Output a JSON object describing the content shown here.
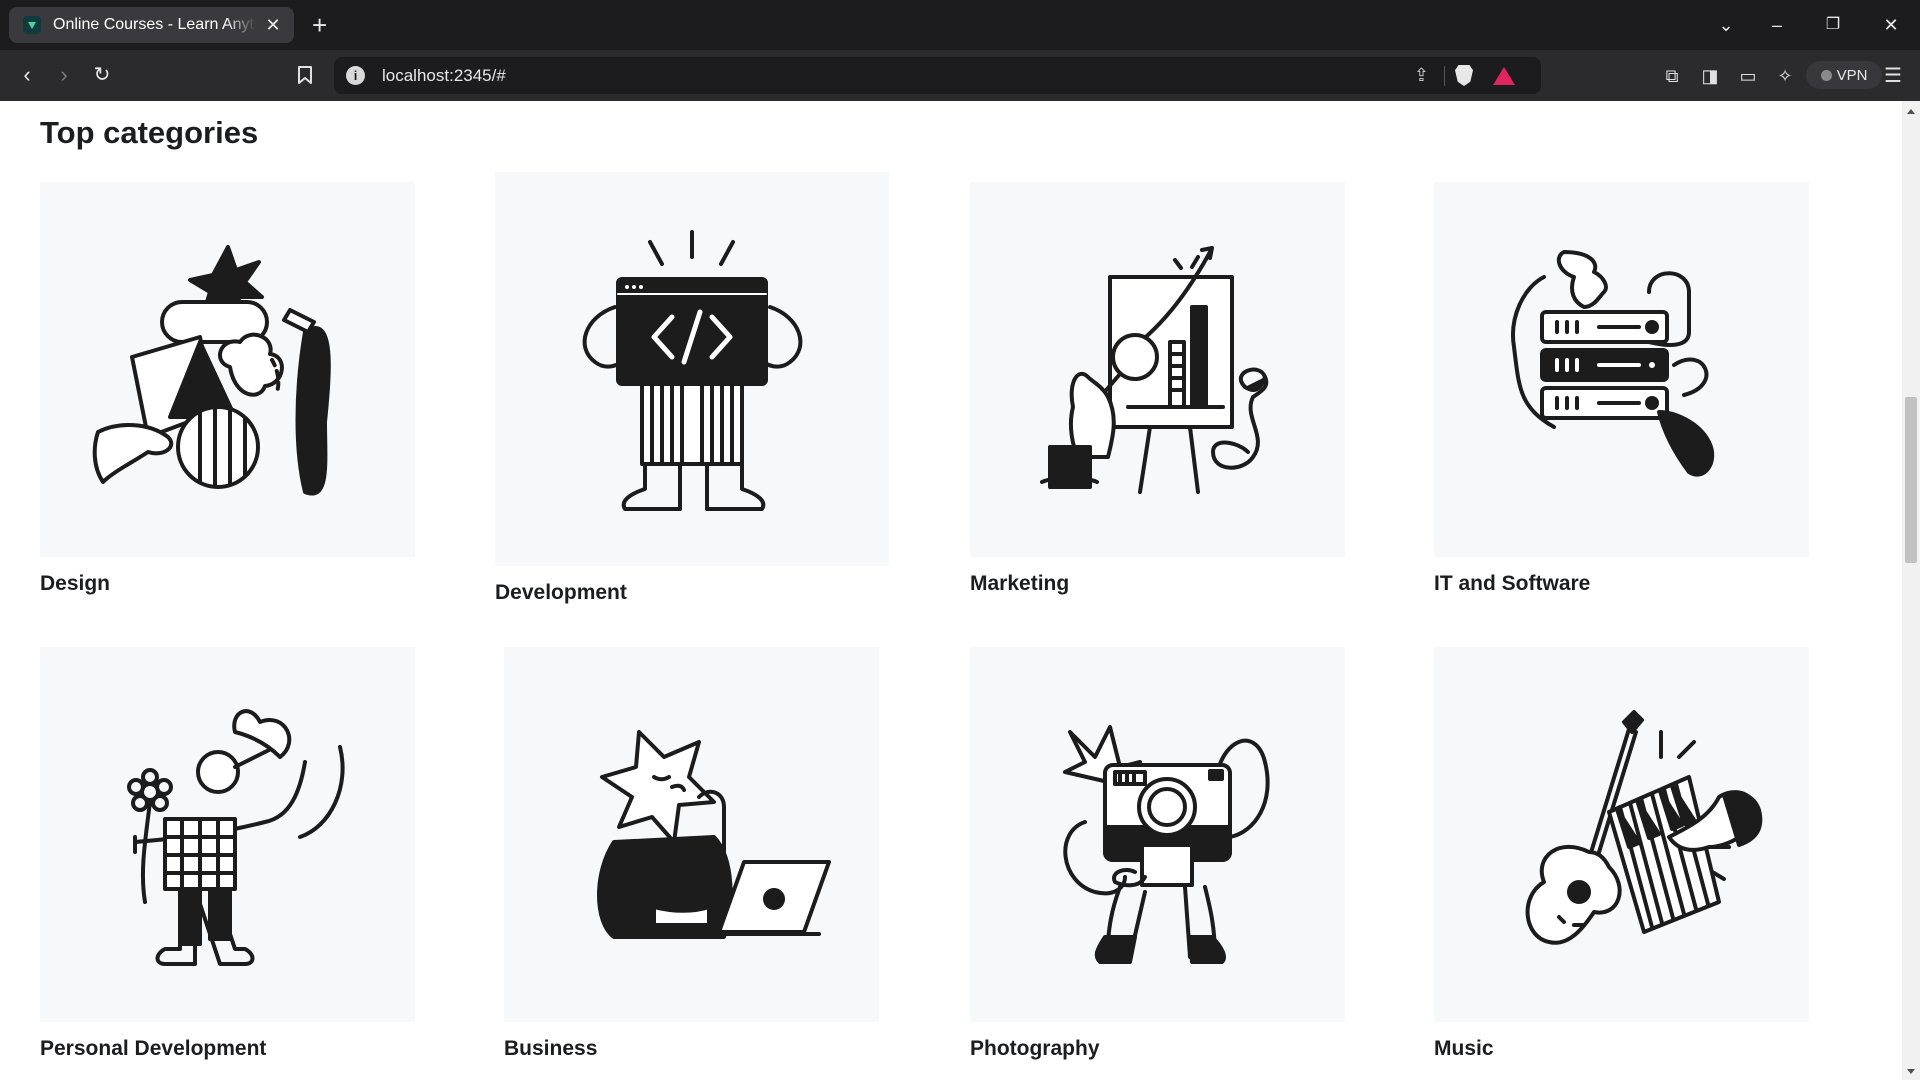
{
  "browser": {
    "tab_title": "Online Courses - Learn Anything, On Your Schedule",
    "tab_close_icon": "✕",
    "new_tab_icon": "+",
    "url": "localhost:2345/#",
    "vpn_label": "VPN",
    "brave_accent": "#e0245e"
  },
  "page": {
    "section_title": "Top categories",
    "categories": [
      {
        "label": "Design",
        "icon": "design-illustration"
      },
      {
        "label": "Development",
        "icon": "development-illustration"
      },
      {
        "label": "Marketing",
        "icon": "marketing-illustration"
      },
      {
        "label": "IT and Software",
        "icon": "it-software-illustration"
      },
      {
        "label": "Personal Development",
        "icon": "personal-development-illustration"
      },
      {
        "label": "Business",
        "icon": "business-illustration"
      },
      {
        "label": "Photography",
        "icon": "photography-illustration"
      },
      {
        "label": "Music",
        "icon": "music-illustration"
      }
    ]
  }
}
